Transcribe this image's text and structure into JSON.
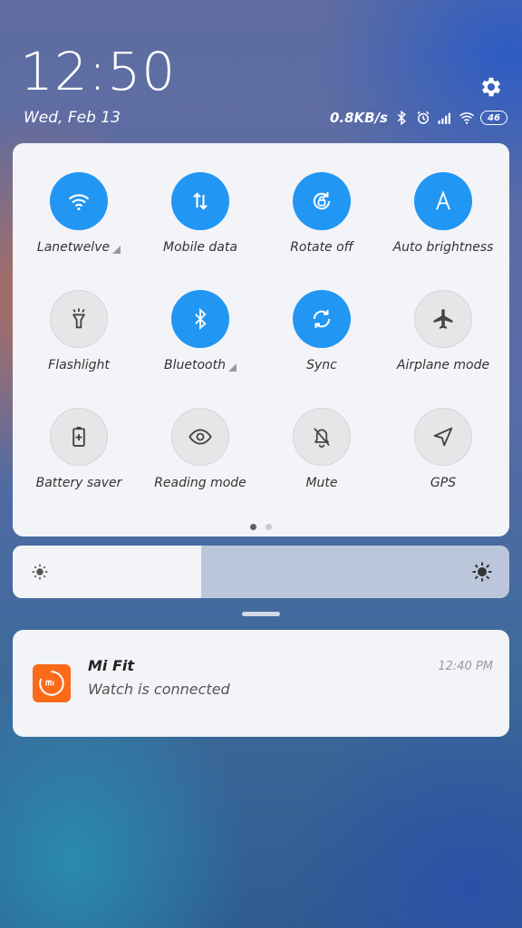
{
  "status": {
    "time": "12:50",
    "date": "Wed, Feb 13",
    "network_speed": "0.8KB/s",
    "battery": "46",
    "icons": [
      "bluetooth-icon",
      "alarm-icon",
      "signal-icon",
      "wifi-icon"
    ]
  },
  "quick_settings": {
    "tiles": [
      {
        "label": "Lanetwelve",
        "state": "on",
        "icon": "wifi-icon",
        "expandable": true
      },
      {
        "label": "Mobile data",
        "state": "on",
        "icon": "data-arrows-icon",
        "expandable": false
      },
      {
        "label": "Rotate off",
        "state": "on",
        "icon": "rotate-lock-icon",
        "expandable": false
      },
      {
        "label": "Auto brightness",
        "state": "on",
        "icon": "auto-brightness-icon",
        "expandable": false
      },
      {
        "label": "Flashlight",
        "state": "off",
        "icon": "flashlight-icon",
        "expandable": false
      },
      {
        "label": "Bluetooth",
        "state": "on",
        "icon": "bluetooth-icon",
        "expandable": true
      },
      {
        "label": "Sync",
        "state": "on",
        "icon": "sync-icon",
        "expandable": false
      },
      {
        "label": "Airplane mode",
        "state": "off",
        "icon": "airplane-icon",
        "expandable": false
      },
      {
        "label": "Battery saver",
        "state": "off",
        "icon": "battery-saver-icon",
        "expandable": false
      },
      {
        "label": "Reading mode",
        "state": "off",
        "icon": "eye-icon",
        "expandable": false
      },
      {
        "label": "Mute",
        "state": "off",
        "icon": "bell-off-icon",
        "expandable": false
      },
      {
        "label": "GPS",
        "state": "off",
        "icon": "location-arrow-icon",
        "expandable": false
      }
    ],
    "page_count": 2,
    "current_page": 1
  },
  "brightness": {
    "level": 0.38
  },
  "notification": {
    "app": "Mi Fit",
    "text": "Watch is connected",
    "time": "12:40 PM",
    "icon": "mi-fit-icon"
  },
  "colors": {
    "accent": "#2196f3",
    "card": "#f3f4f8",
    "mi_fit_orange": "#fa6a18"
  }
}
